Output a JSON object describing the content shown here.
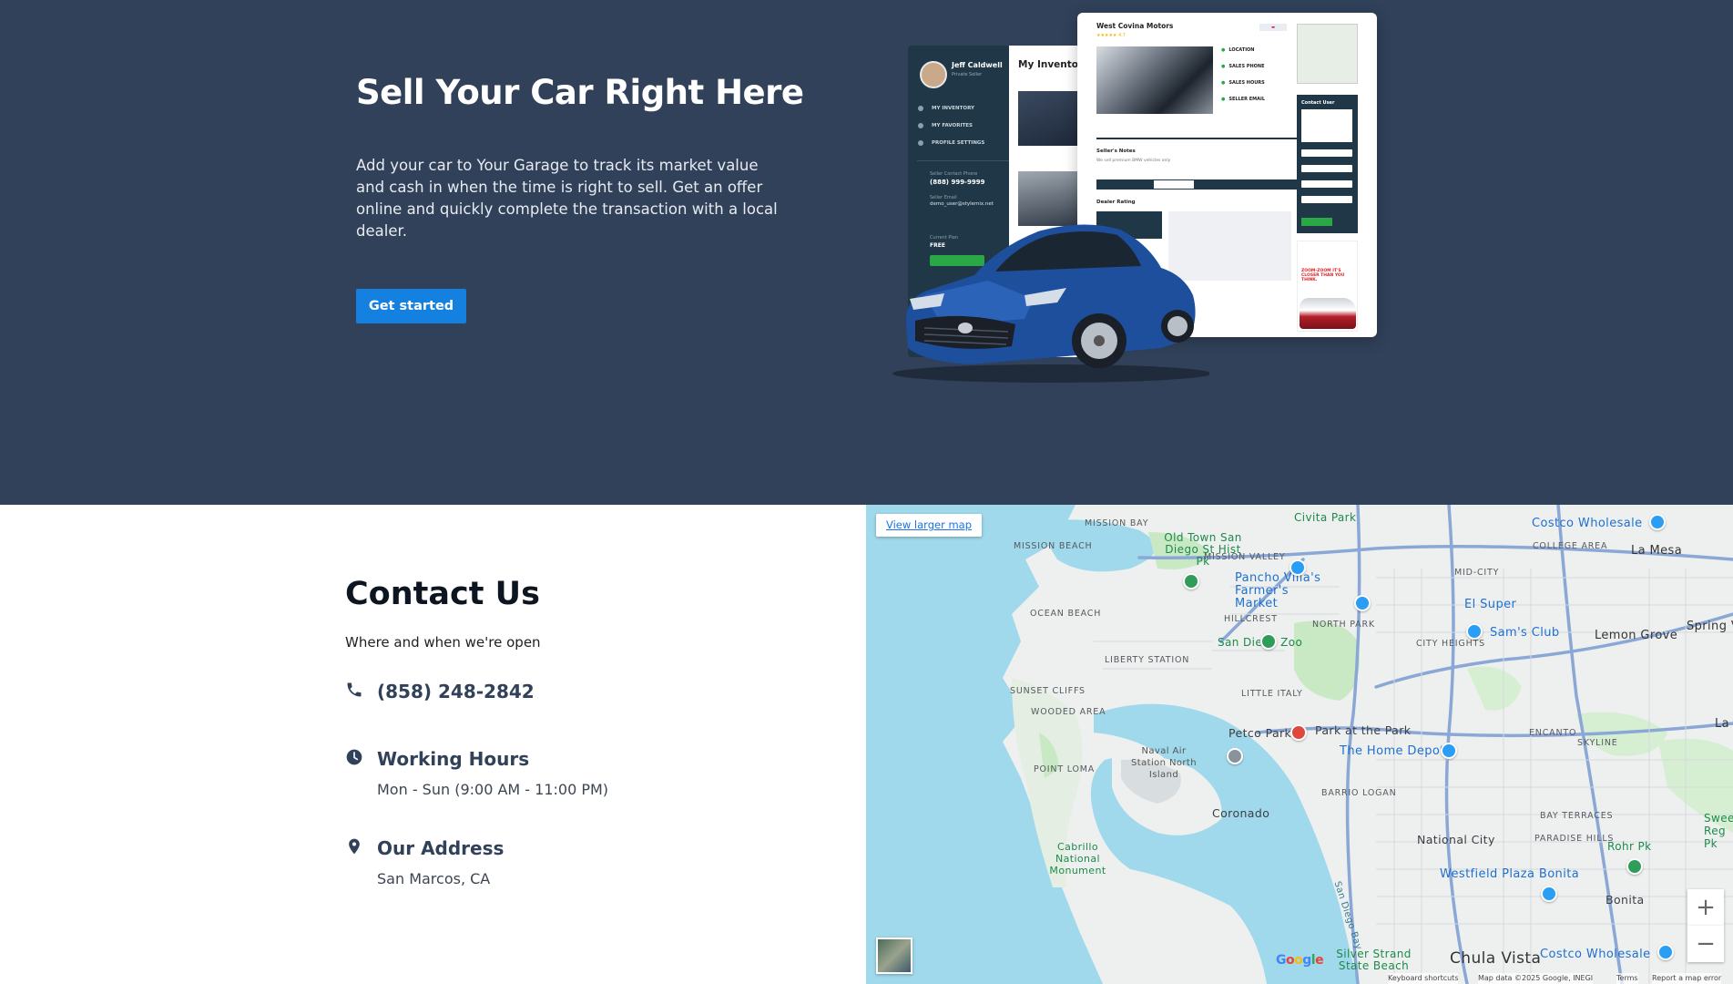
{
  "hero": {
    "title": "Sell Your Car Right Here",
    "description": "Add your car to Your Garage to track its market value and cash in when the time is right to sell. Get an offer online and quickly complete the transaction with a local dealer.",
    "button_label": "Get started",
    "colors": {
      "background": "#304159",
      "button": "#1480e0"
    }
  },
  "mockup": {
    "profile_name": "Jeff Caldwell",
    "profile_role": "Private Seller",
    "nav": [
      "MY INVENTORY",
      "MY FAVORITES",
      "PROFILE SETTINGS"
    ],
    "phone_label": "Seller Contact Phone",
    "phone": "(888) 999-9999",
    "email_label": "Seller Email",
    "email": "demo_user@stylemix.net",
    "plan_label": "Current Plan",
    "plan": "FREE",
    "inventory_title": "My Inventory",
    "dealer_title": "West Covina Motors",
    "dealer_rating": "★★★★★ 4.7",
    "info_rows": [
      "LOCATION",
      "SALES PHONE",
      "SALES HOURS",
      "SELLER EMAIL"
    ],
    "notes_title": "Seller's Notes",
    "notes_text": "We sell premium BMW vehicles only",
    "rating_title": "Dealer Rating",
    "contact_title": "Contact User",
    "ad_text": "ZOOM-ZOOM IT'S CLOSER THAN YOU THINK."
  },
  "contact": {
    "title": "Contact Us",
    "subtitle": "Where and when we're open",
    "phone": "(858) 248-2842",
    "hours_title": "Working Hours",
    "hours": "Mon - Sun (9:00 AM - 11:00 PM)",
    "address_title": "Our Address",
    "address": "San Marcos, CA",
    "icon_names": [
      "phone-icon",
      "clock-icon",
      "map-pin-icon"
    ]
  },
  "map": {
    "view_larger": "View larger map",
    "zoom_in": "+",
    "zoom_out": "−",
    "attribution": {
      "shortcuts": "Keyboard shortcuts",
      "data": "Map data ©2025 Google, INEGI",
      "terms": "Terms",
      "report": "Report a map error"
    },
    "google": "Google",
    "labels": {
      "mission_bay": "MISSION BAY",
      "mission_beach": "MISSION BEACH",
      "old_town": "Old Town San Diego St Hist Pk",
      "mission_valley": "MISSION VALLEY",
      "civita": "Civita Park",
      "costco1": "Costco Wholesale",
      "college_area": "COLLEGE AREA",
      "la_mesa": "La Mesa",
      "mid_city": "MID-CITY",
      "pancho": "Pancho Villa's Farmer's Market",
      "el_super": "El Super",
      "ocean_beach": "OCEAN BEACH",
      "hillcrest": "HILLCREST",
      "zoo": "San Diego Zoo",
      "north_park": "NORTH PARK",
      "city_heights": "CITY HEIGHTS",
      "sams": "Sam's Club",
      "lemon_grove": "Lemon Grove",
      "spring_valley": "Spring Va",
      "liberty": "LIBERTY STATION",
      "sunset_cliffs": "SUNSET CLIFFS",
      "little_italy": "LITTLE ITALY",
      "wooded": "WOODED AREA",
      "petco": "Petco Park",
      "park_at_park": "Park at the Park",
      "encanto": "ENCANTO",
      "la": "La",
      "naval": "Naval Air Station North Island",
      "home_depot": "The Home Depot",
      "skyline": "SKYLINE",
      "point_loma": "POINT LOMA",
      "barrio": "BARRIO LOGAN",
      "coronado": "Coronado",
      "bay_terraces": "BAY TERRACES",
      "sweetwater": "Sweetwa Reg Pk",
      "cabrillo": "Cabrillo National Monument",
      "national_city": "National City",
      "paradise_hills": "PARADISE HILLS",
      "rohr": "Rohr Pk",
      "san_diego_bay": "San Diego Bay",
      "westfield": "Westfield Plaza Bonita",
      "bonita": "Bonita",
      "silver_strand": "Silver Strand State Beach",
      "chula_vista": "Chula Vista",
      "costco2": "Costco Wholesale"
    }
  }
}
